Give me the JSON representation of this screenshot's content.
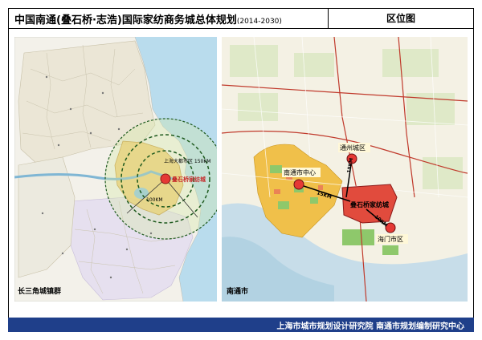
{
  "header": {
    "title": "中国南通(叠石桥·志浩)国际家纺商务城总体规划",
    "years": "(2014-2030)",
    "sheet_name": "区位图"
  },
  "left_map": {
    "caption": "长三角城镇群",
    "ring_label_inner": "上海大都市区 150KM",
    "ring_label_mid": "100KM",
    "site_label": "叠石桥家纺城",
    "colors": {
      "sea": "#b9dced",
      "land": "#f3f1ea",
      "region": "#f2c96b",
      "ring": "#1e5a1e",
      "ring_fill": "#d3e9a5"
    }
  },
  "right_map": {
    "caption": "南通市",
    "cities": [
      {
        "name": "通州城区"
      },
      {
        "name": "南通市中心"
      },
      {
        "name": "叠石桥家纺城"
      },
      {
        "name": "海门市区"
      }
    ],
    "distances": [
      "15KM",
      "15KM",
      "10KM"
    ],
    "colors": {
      "site": "#e14b3d",
      "river": "#9ec8de",
      "urban": "#f0c04a",
      "green": "#8ec86b",
      "road": "#c0392b"
    }
  },
  "footer": {
    "text": "上海市城市规划设计研究院  南通市规划编制研究中心"
  }
}
